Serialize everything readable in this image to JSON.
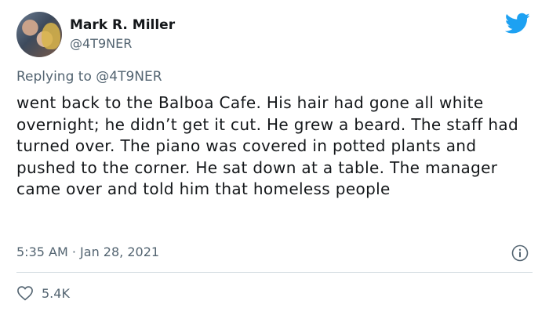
{
  "author": {
    "display_name": "Mark R. Miller",
    "handle": "@4T9NER"
  },
  "reply": {
    "prefix": "Replying to",
    "mention": "@4T9NER"
  },
  "tweet": {
    "text": "went back to the Balboa Cafe. His hair had gone all white overnight; he didn’t get it cut. He grew a beard. The staff had turned over. The piano was covered in potted plants and pushed to the corner. He sat down at a table. The manager came over and told him that homeless people",
    "time": "5:35 AM",
    "separator": "·",
    "date": "Jan 28, 2021"
  },
  "stats": {
    "likes": "5.4K"
  },
  "icons": {
    "brand": "twitter-bird-icon",
    "info": "info-icon",
    "like": "heart-icon"
  },
  "colors": {
    "brand": "#1DA1F2",
    "secondary_text": "#536471",
    "divider": "#CFD9DE"
  }
}
